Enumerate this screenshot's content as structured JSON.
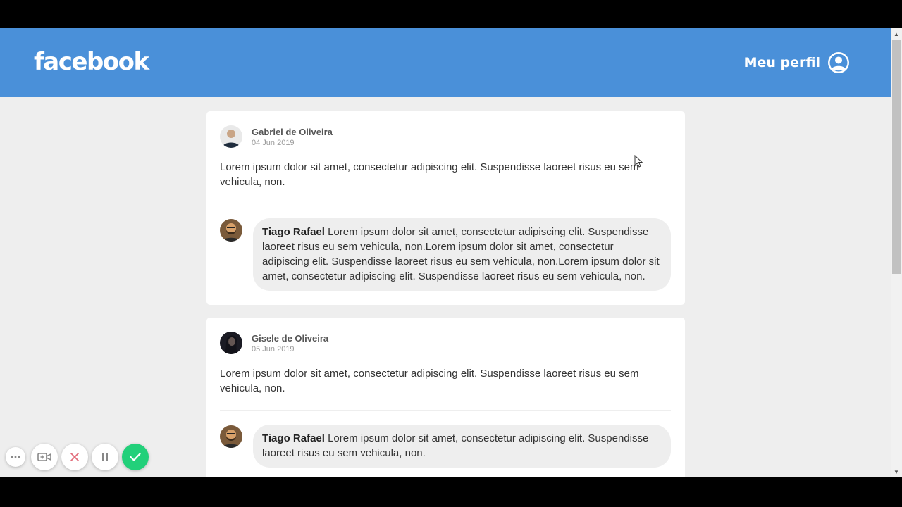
{
  "header": {
    "logo": "facebook",
    "profile_label": "Meu perfil",
    "profile_icon": "user-circle-icon",
    "color": "#4a90d9"
  },
  "posts": [
    {
      "author": "Gabriel de Oliveira",
      "date": "04 Jun 2019",
      "content": "Lorem ipsum dolor sit amet, consectetur adipiscing elit. Suspendisse laoreet risus eu sem vehicula, non.",
      "comment": {
        "author": "Tiago Rafael",
        "text": " Lorem ipsum dolor sit amet, consectetur adipiscing elit. Suspendisse laoreet risus eu sem vehicula, non.Lorem ipsum dolor sit amet, consectetur adipiscing elit. Suspendisse laoreet risus eu sem vehicula, non.Lorem ipsum dolor sit amet, consectetur adipiscing elit. Suspendisse laoreet risus eu sem vehicula, non."
      }
    },
    {
      "author": "Gisele de Oliveira",
      "date": "05 Jun 2019",
      "content": "Lorem ipsum dolor sit amet, consectetur adipiscing elit. Suspendisse laoreet risus eu sem vehicula, non.",
      "comment": {
        "author": "Tiago Rafael",
        "text": " Lorem ipsum dolor sit amet, consectetur adipiscing elit. Suspendisse laoreet risus eu sem vehicula, non."
      }
    }
  ],
  "recorder": {
    "icons": [
      "more-options-icon",
      "camera-toggle-icon",
      "cancel-icon",
      "pause-icon",
      "finish-check-icon"
    ],
    "accent": "#22d07a"
  }
}
